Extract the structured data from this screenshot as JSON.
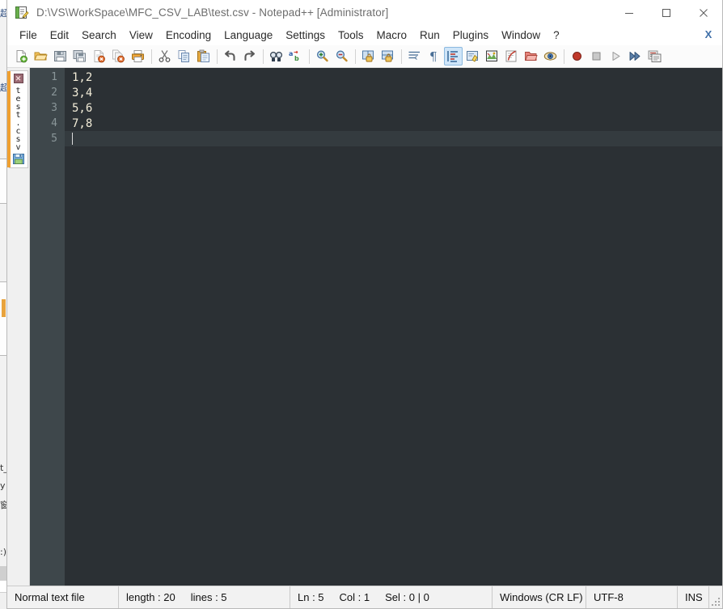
{
  "window": {
    "title": "D:\\VS\\WorkSpace\\MFC_CSV_LAB\\test.csv - Notepad++ [Administrator]",
    "app_icon": "notepad-plus-plus-icon",
    "controls": {
      "minimize": "—",
      "maximize": "□",
      "close": "✕"
    }
  },
  "menubar": {
    "items": [
      {
        "label": "File"
      },
      {
        "label": "Edit"
      },
      {
        "label": "Search"
      },
      {
        "label": "View"
      },
      {
        "label": "Encoding"
      },
      {
        "label": "Language"
      },
      {
        "label": "Settings"
      },
      {
        "label": "Tools"
      },
      {
        "label": "Macro"
      },
      {
        "label": "Run"
      },
      {
        "label": "Plugins"
      },
      {
        "label": "Window"
      },
      {
        "label": "?"
      }
    ],
    "close_document_label": "X"
  },
  "toolbar": {
    "buttons": [
      {
        "name": "new-file-icon",
        "tip": "New"
      },
      {
        "name": "open-file-icon",
        "tip": "Open"
      },
      {
        "name": "save-icon",
        "tip": "Save"
      },
      {
        "name": "save-all-icon",
        "tip": "Save All"
      },
      {
        "name": "close-file-icon",
        "tip": "Close"
      },
      {
        "name": "close-all-files-icon",
        "tip": "Close All"
      },
      {
        "name": "print-icon",
        "tip": "Print"
      },
      {
        "name": "separator",
        "tip": ""
      },
      {
        "name": "cut-icon",
        "tip": "Cut"
      },
      {
        "name": "copy-icon",
        "tip": "Copy"
      },
      {
        "name": "paste-icon",
        "tip": "Paste"
      },
      {
        "name": "separator",
        "tip": ""
      },
      {
        "name": "undo-icon",
        "tip": "Undo"
      },
      {
        "name": "redo-icon",
        "tip": "Redo"
      },
      {
        "name": "separator",
        "tip": ""
      },
      {
        "name": "find-icon",
        "tip": "Find"
      },
      {
        "name": "replace-icon",
        "tip": "Replace"
      },
      {
        "name": "separator",
        "tip": ""
      },
      {
        "name": "zoom-in-icon",
        "tip": "Zoom In"
      },
      {
        "name": "zoom-out-icon",
        "tip": "Zoom Out"
      },
      {
        "name": "separator",
        "tip": ""
      },
      {
        "name": "sync-vertical-scroll-icon",
        "tip": "Synchronize Vertical Scrolling"
      },
      {
        "name": "sync-horizontal-scroll-icon",
        "tip": "Synchronize Horizontal Scrolling"
      },
      {
        "name": "separator",
        "tip": ""
      },
      {
        "name": "word-wrap-icon",
        "tip": "Word wrap"
      },
      {
        "name": "show-all-characters-icon",
        "tip": "Show All Characters"
      },
      {
        "name": "show-indent-guide-icon",
        "tip": "Show Indent Guide",
        "active": true
      },
      {
        "name": "user-defined-language-icon",
        "tip": "User-Defined Dialogue"
      },
      {
        "name": "document-map-icon",
        "tip": "Document Map"
      },
      {
        "name": "function-list-icon",
        "tip": "Function List"
      },
      {
        "name": "folder-as-workspace-icon",
        "tip": "Folder as Workspace"
      },
      {
        "name": "monitoring-icon",
        "tip": "Monitoring (tail -f)"
      },
      {
        "name": "separator",
        "tip": ""
      },
      {
        "name": "record-macro-icon",
        "tip": "Start Recording"
      },
      {
        "name": "stop-macro-icon",
        "tip": "Stop Recording"
      },
      {
        "name": "play-macro-icon",
        "tip": "Playback"
      },
      {
        "name": "run-macro-multiple-icon",
        "tip": "Run a Macro Multiple Times"
      },
      {
        "name": "save-macro-icon",
        "tip": "Save Current Recorded Macro"
      }
    ]
  },
  "tabs": {
    "active_index": 0,
    "items": [
      {
        "label": "test.csv",
        "close_glyph": "✕",
        "state_icon": "saved-floppy-icon"
      }
    ]
  },
  "editor": {
    "line_numbers": [
      "1",
      "2",
      "3",
      "4",
      "5"
    ],
    "lines": [
      "1,2",
      "3,4",
      "5,6",
      "7,8",
      ""
    ],
    "current_line": 5,
    "colors": {
      "background": "#2b3034",
      "gutter": "#3e474b",
      "text": "#f2ecd8",
      "line_number": "#8a9699",
      "current_line": "#343b3f"
    }
  },
  "statusbar": {
    "file_type": "Normal text file",
    "length_label": "length : 20",
    "lines_label": "lines : 5",
    "ln_label": "Ln : 5",
    "col_label": "Col : 1",
    "sel_label": "Sel : 0 | 0",
    "eol": "Windows (CR LF)",
    "encoding": "UTF-8",
    "insert_mode": "INS"
  },
  "background_windows": {
    "fragments": [
      "超",
      "超",
      "t_",
      "y",
      "窗",
      ":)"
    ]
  }
}
